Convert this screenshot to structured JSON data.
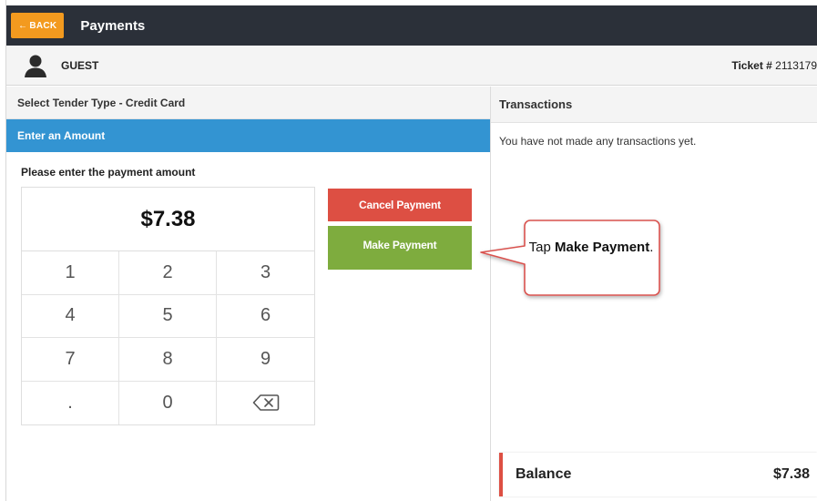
{
  "header": {
    "back_label": "BACK",
    "title": "Payments"
  },
  "guest": {
    "name": "GUEST",
    "ticket_label": "Ticket #",
    "ticket_number": "2113179"
  },
  "left": {
    "tender_type": "Select Tender Type - Credit Card",
    "amount_header": "Enter an Amount",
    "prompt": "Please enter the payment amount",
    "amount": "$7.38",
    "keys": [
      "1",
      "2",
      "3",
      "4",
      "5",
      "6",
      "7",
      "8",
      "9",
      ".",
      "0"
    ],
    "cancel_label": "Cancel Payment",
    "make_label": "Make Payment"
  },
  "right": {
    "header": "Transactions",
    "empty_message": "You have not made any transactions yet.",
    "balance_label": "Balance",
    "balance_value": "$7.38"
  },
  "callout": {
    "prefix": "Tap ",
    "bold": "Make Payment",
    "suffix": "."
  },
  "colors": {
    "topbar": "#2b3039",
    "back": "#f39a1f",
    "amount_header": "#3394d2",
    "cancel": "#dd4f43",
    "make": "#7eac3e",
    "callout_border": "#d9534f"
  },
  "icons": {
    "back": "arrow-left-icon",
    "avatar": "user-avatar-icon",
    "backspace": "backspace-icon"
  }
}
